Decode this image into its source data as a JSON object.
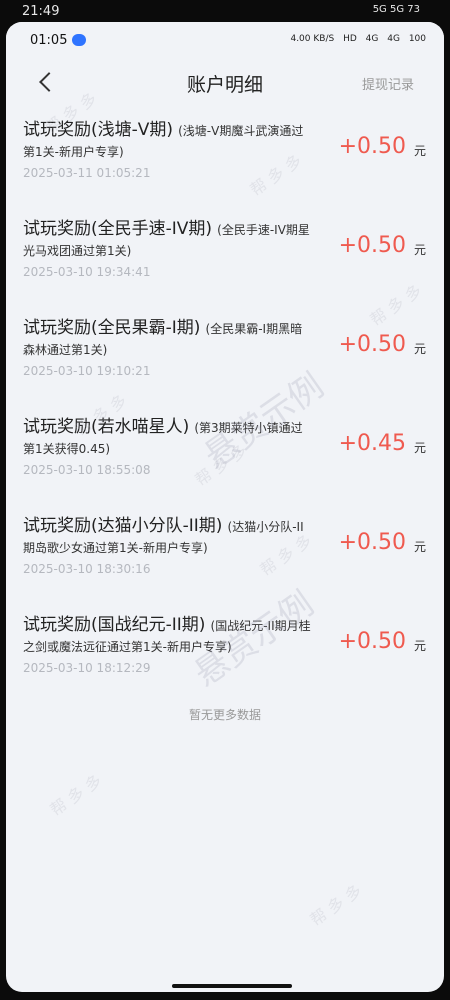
{
  "outer_status": {
    "time": "21:49",
    "network": "5G  5G  73"
  },
  "status_bar": {
    "time": "01:05",
    "speed": "4.00 KB/S",
    "hd": "HD",
    "signals": [
      "4G",
      "4G"
    ],
    "battery": "100"
  },
  "header": {
    "title": "账户明细",
    "right_link": "提现记录"
  },
  "records": [
    {
      "title": "试玩奖励(浅塘-V期)",
      "desc": "(浅塘-V期魔斗武演通过第1关-新用户专享)",
      "date": "2025-03-11 01:05:21",
      "amount": "+0.50",
      "unit": "元"
    },
    {
      "title": "试玩奖励(全民手速-IV期)",
      "desc": "(全民手速-IV期星光马戏团通过第1关)",
      "date": "2025-03-10 19:34:41",
      "amount": "+0.50",
      "unit": "元"
    },
    {
      "title": "试玩奖励(全民果霸-I期)",
      "desc": "(全民果霸-I期黑暗森林通过第1关)",
      "date": "2025-03-10 19:10:21",
      "amount": "+0.50",
      "unit": "元"
    },
    {
      "title": "试玩奖励(若水喵星人)",
      "desc": "(第3期莱特小镇通过第1关获得0.45)",
      "date": "2025-03-10 18:55:08",
      "amount": "+0.45",
      "unit": "元"
    },
    {
      "title": "试玩奖励(达猫小分队-II期)",
      "desc": "(达猫小分队-II期岛歌少女通过第1关-新用户专享)",
      "date": "2025-03-10 18:30:16",
      "amount": "+0.50",
      "unit": "元"
    },
    {
      "title": "试玩奖励(国战纪元-II期)",
      "desc": "(国战纪元-II期月桂之剑或魔法远征通过第1关-新用户专享)",
      "date": "2025-03-10 18:12:29",
      "amount": "+0.50",
      "unit": "元"
    }
  ],
  "footer": {
    "no_more": "暂无更多数据"
  },
  "watermarks": {
    "small": "帮 多 多",
    "large1": "悬赏示例",
    "large2": "悬赏示例"
  }
}
